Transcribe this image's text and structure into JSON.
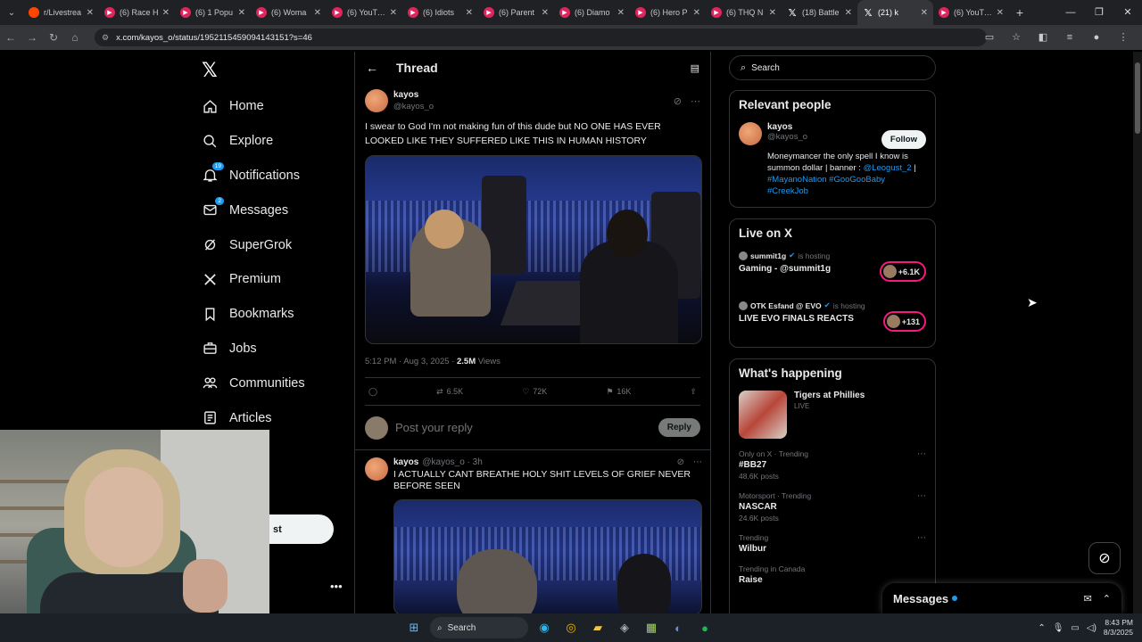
{
  "browser": {
    "tabs": [
      {
        "label": "r/Livestrea",
        "icon": "reddit-icon"
      },
      {
        "label": "(6) Race H",
        "icon": "youtube-icon"
      },
      {
        "label": "(6) 1 Popu",
        "icon": "youtube-icon"
      },
      {
        "label": "(6) Woma",
        "icon": "youtube-icon"
      },
      {
        "label": "(6) YouTub",
        "icon": "youtube-icon"
      },
      {
        "label": "(6) Idiots",
        "icon": "youtube-icon"
      },
      {
        "label": "(6) Parent",
        "icon": "youtube-icon"
      },
      {
        "label": "(6) Diamo",
        "icon": "youtube-icon"
      },
      {
        "label": "(6) Hero P",
        "icon": "youtube-icon"
      },
      {
        "label": "(6) THQ N",
        "icon": "youtube-icon"
      },
      {
        "label": "(18) Battle",
        "icon": "x-icon"
      },
      {
        "label": "(21) k",
        "icon": "x-icon",
        "active": true
      },
      {
        "label": "(6) YouTub",
        "icon": "youtube-icon"
      }
    ],
    "url": "x.com/kayos_o/status/1952115459094143151?s=46"
  },
  "nav": {
    "items": [
      {
        "label": "Home",
        "icon": "home-icon"
      },
      {
        "label": "Explore",
        "icon": "search-icon"
      },
      {
        "label": "Notifications",
        "icon": "bell-icon",
        "badge": "19"
      },
      {
        "label": "Messages",
        "icon": "mail-icon",
        "badge": "2"
      },
      {
        "label": "SuperGrok",
        "icon": "grok-icon"
      },
      {
        "label": "Premium",
        "icon": "x-icon"
      },
      {
        "label": "Bookmarks",
        "icon": "bookmark-icon"
      },
      {
        "label": "Jobs",
        "icon": "briefcase-icon"
      },
      {
        "label": "Communities",
        "icon": "people-icon"
      },
      {
        "label": "Articles",
        "icon": "article-icon"
      }
    ],
    "post_button_partial": "st",
    "more": "•••"
  },
  "thread": {
    "title": "Thread",
    "main_post": {
      "name": "kayos",
      "handle": "@kayos_o",
      "text": "I swear to God I'm not making fun of this dude but NO ONE HAS EVER LOOKED LIKE THEY SUFFERED LIKE THIS IN HUMAN HISTORY",
      "time": "5:12 PM · Aug 3, 2025 · ",
      "views": "2.5M",
      "views_label": " Views",
      "reposts": "6.5K",
      "likes": "72K",
      "bookmarks": "16K"
    },
    "reply_placeholder": "Post your reply",
    "reply_button": "Reply",
    "second_post": {
      "name": "kayos",
      "handle": "@kayos_o · 3h",
      "text": "I ACTUALLY CANT BREATHE HOLY SHIT LEVELS OF GRIEF NEVER BEFORE SEEN"
    }
  },
  "right": {
    "search_placeholder": "Search",
    "relevant": {
      "title": "Relevant people",
      "name": "kayos",
      "handle": "@kayos_o",
      "follow": "Follow",
      "bio_text": "Moneymancer the only spell I know is summon dollar | banner : ",
      "bio_link1": "@Leogust_2",
      "bio_sep": " | ",
      "bio_tags": "#MayanoNation #GooGooBaby #CreekJob"
    },
    "live": {
      "title": "Live on X",
      "items": [
        {
          "host": "summit1g",
          "status": "is hosting",
          "title": "Gaming - @summit1g",
          "count": "+6.1K"
        },
        {
          "host": "OTK Esfand @ EVO",
          "status": "is hosting",
          "title": "LIVE EVO FINALS REACTS",
          "count": "+131"
        }
      ]
    },
    "happening": {
      "title": "What's happening",
      "featured": {
        "title": "Tigers at Phillies",
        "status": "LIVE"
      },
      "trends": [
        {
          "context": "Only on X · Trending",
          "topic": "#BB27",
          "posts": "48.6K posts"
        },
        {
          "context": "Motorsport · Trending",
          "topic": "NASCAR",
          "posts": "24.6K posts"
        },
        {
          "context": "Trending",
          "topic": "Wilbur",
          "posts": ""
        },
        {
          "context": "Trending in Canada",
          "topic": "Raise",
          "posts": ""
        }
      ]
    },
    "messages_drawer": "Messages"
  },
  "taskbar": {
    "search": "Search",
    "time": "8:43 PM",
    "date": "8/3/2025"
  }
}
